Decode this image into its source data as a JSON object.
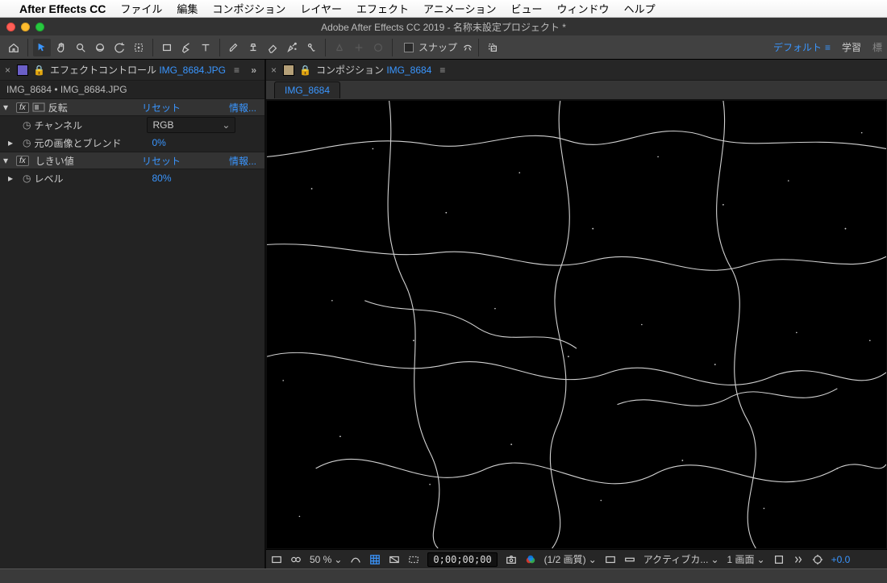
{
  "mac_menu": {
    "app_name": "After Effects CC",
    "items": [
      "ファイル",
      "編集",
      "コンポジション",
      "レイヤー",
      "エフェクト",
      "アニメーション",
      "ビュー",
      "ウィンドウ",
      "ヘルプ"
    ]
  },
  "window_title": "Adobe After Effects CC 2019 - 名称未設定プロジェクト *",
  "workspace": {
    "active": "デフォルト",
    "secondary": "学習",
    "extra": "標"
  },
  "snap_label": "スナップ",
  "effect_panel": {
    "tab_prefix": "エフェクトコントロール ",
    "tab_file": "IMG_8684.JPG",
    "breadcrumb": "IMG_8684 • IMG_8684.JPG",
    "reset_label": "リセット",
    "info_label": "情報...",
    "fx": [
      {
        "name": "反転",
        "props": [
          {
            "label": "チャンネル",
            "type": "dropdown",
            "value": "RGB"
          },
          {
            "label": "元の画像とブレンド",
            "type": "value",
            "value": "0%"
          }
        ]
      },
      {
        "name": "しきい値",
        "props": [
          {
            "label": "レベル",
            "type": "value",
            "value": "80%"
          }
        ]
      }
    ]
  },
  "comp_panel": {
    "tab_prefix": "コンポジション ",
    "tab_name": "IMG_8684",
    "footer_tab": "IMG_8684"
  },
  "bottombar": {
    "zoom": "50 %",
    "timecode": "0;00;00;00",
    "quality": "(1/2 画質)",
    "camera": "アクティブカ...",
    "views": "1 画面",
    "exposure": "+0.0"
  }
}
